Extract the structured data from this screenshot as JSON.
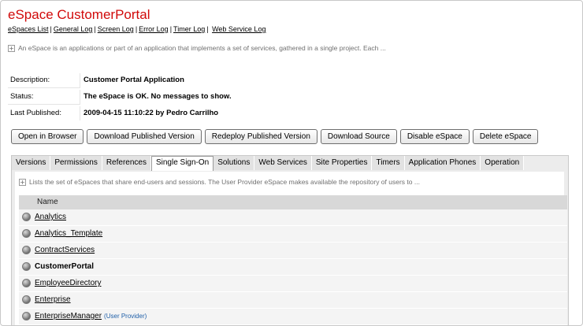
{
  "header": {
    "title": "eSpace CustomerPortal",
    "nav": [
      {
        "label": "eSpaces List"
      },
      {
        "label": "General Log"
      },
      {
        "label": "Screen Log"
      },
      {
        "label": "Error Log"
      },
      {
        "label": "Timer Log"
      },
      {
        "label": "Web Service Log"
      }
    ],
    "separator": "|",
    "description": "An eSpace is an applications or part of an application that implements a set of services, gathered in a single project. Each ...",
    "toggle_symbol": "+"
  },
  "info": [
    {
      "label": "Description:",
      "value": "Customer Portal Application"
    },
    {
      "label": "Status:",
      "value": "The eSpace is OK. No messages to show."
    },
    {
      "label": "Last Published:",
      "value": "2009-04-15 11:10:22 by Pedro Carrilho"
    }
  ],
  "buttons": [
    {
      "label": "Open in Browser"
    },
    {
      "label": "Download Published Version"
    },
    {
      "label": "Redeploy Published Version"
    },
    {
      "label": "Download Source"
    },
    {
      "label": "Disable eSpace"
    },
    {
      "label": "Delete eSpace"
    }
  ],
  "tabs": [
    {
      "label": "Versions"
    },
    {
      "label": "Permissions"
    },
    {
      "label": "References"
    },
    {
      "label": "Single Sign-On",
      "active": true
    },
    {
      "label": "Solutions"
    },
    {
      "label": "Web Services"
    },
    {
      "label": "Site Properties"
    },
    {
      "label": "Timers"
    },
    {
      "label": "Application Phones"
    },
    {
      "label": "Operation"
    }
  ],
  "panel": {
    "description": "Lists the set of eSpaces that share end-users and sessions. The User Provider eSpace makes available the repository of users to ...",
    "column_header": "Name",
    "rows": [
      {
        "name": "Analytics",
        "link": true
      },
      {
        "name": "Analytics_Template",
        "link": true
      },
      {
        "name": "ContractServices",
        "link": true
      },
      {
        "name": "CustomerPortal",
        "link": false
      },
      {
        "name": "EmployeeDirectory",
        "link": true
      },
      {
        "name": "Enterprise",
        "link": true
      },
      {
        "name": "EnterpriseManager",
        "link": true,
        "badge": "(User Provider)"
      }
    ]
  },
  "colors": {
    "title": "#d10a0a",
    "provider_badge": "#1f5fa8",
    "header_row": "#d8d8d8"
  },
  "icons": {
    "expand": "expand-toggle-icon",
    "row_bullet": "espace-bullet-icon"
  }
}
